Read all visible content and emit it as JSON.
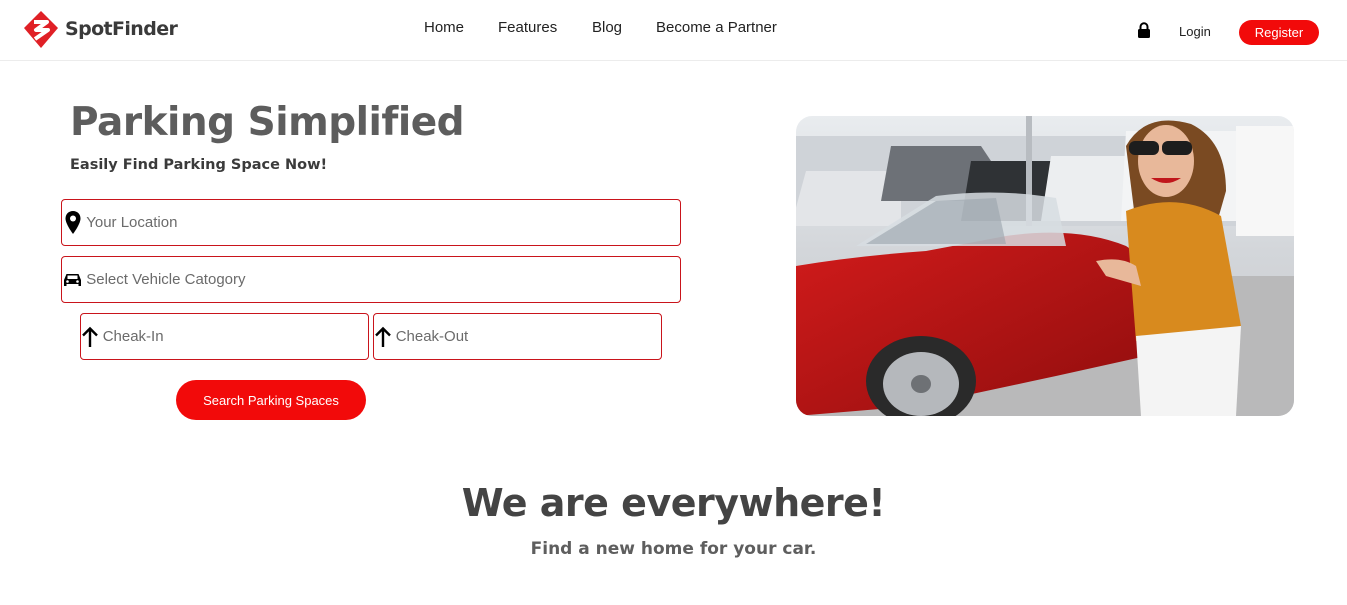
{
  "brand": {
    "name": "SpotFinder",
    "accent": "#f20a0a"
  },
  "nav": {
    "items": [
      "Home",
      "Features",
      "Blog",
      "Become a Partner"
    ]
  },
  "auth": {
    "login_label": "Login",
    "register_label": "Register",
    "lock_icon": "lock-icon"
  },
  "hero": {
    "title": "Parking Simplified",
    "subtitle": "Easily Find Parking Space Now!",
    "location_placeholder": "Your Location",
    "vehicle_placeholder": "Select Vehicle Catogory",
    "checkin_placeholder": "Cheak-In",
    "checkout_placeholder": "Cheak-Out",
    "search_label": "Search Parking Spaces",
    "icons": {
      "location": "map-pin-icon",
      "vehicle": "car-icon",
      "checkin": "arrow-up-icon",
      "checkout": "arrow-up-icon"
    }
  },
  "section": {
    "title": "We are everywhere!",
    "subtitle": "Find a new home for your car."
  }
}
